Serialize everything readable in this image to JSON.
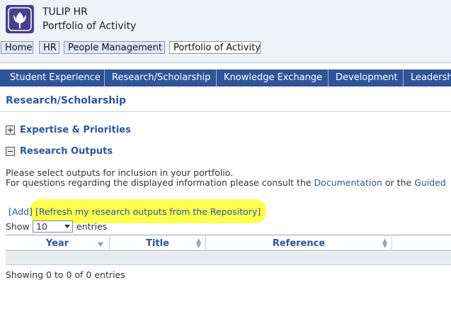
{
  "header": {
    "title": "TULIP HR",
    "subtitle": "Portfolio of Activity",
    "logo_icon": "tulip-icon"
  },
  "breadcrumb": [
    "Home",
    "HR",
    "People Management",
    "Portfolio of Activity"
  ],
  "tabs": [
    "Student Experience",
    "Research/Scholarship",
    "Knowledge Exchange",
    "Development",
    "Leadership"
  ],
  "section": {
    "title": "Research/Scholarship",
    "items": [
      {
        "label": "Expertise & Priorities",
        "state": "collapsed",
        "icon": "plus-icon"
      },
      {
        "label": "Research Outputs",
        "state": "expanded",
        "icon": "minus-icon"
      }
    ]
  },
  "instructions": {
    "line1": "Please select outputs for inclusion in your portfolio.",
    "line2_prefix": "For questions regarding the displayed information please consult the",
    "documentation_link": "Documentation",
    "line2_mid": "or the",
    "guided_link": "Guided"
  },
  "actions": {
    "add": "[Add]",
    "refresh": "[Refresh my research outputs from the Repository]"
  },
  "length_menu": {
    "prefix": "Show",
    "value": "10",
    "suffix": "entries"
  },
  "table": {
    "columns": [
      "Year",
      "Title",
      "Reference",
      ""
    ]
  },
  "info": "Showing 0 to 0 of 0 entries",
  "colors": {
    "tab_bar": "#2f5597",
    "highlight": "#ffff4d",
    "link": "#2f5597"
  }
}
